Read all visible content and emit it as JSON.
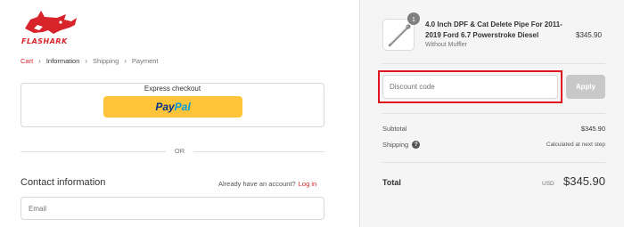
{
  "brand": {
    "logo_text": "FLASHARK",
    "accent_color": "#d8232a"
  },
  "breadcrumb": [
    {
      "label": "Cart",
      "state": "link"
    },
    {
      "label": "Information",
      "state": "current"
    },
    {
      "label": "Shipping",
      "state": "upcoming"
    },
    {
      "label": "Payment",
      "state": "upcoming"
    }
  ],
  "express": {
    "title": "Express checkout",
    "paypal_part1": "Pay",
    "paypal_part2": "Pal"
  },
  "divider_label": "OR",
  "contact": {
    "title": "Contact information",
    "account_prompt": "Already have an account?",
    "login_label": "Log in",
    "email_placeholder": "Email"
  },
  "order": {
    "quantity": "1",
    "product_name": "4.0 Inch DPF & Cat Delete Pipe For 2011-2019 Ford 6.7 Powerstroke Diesel",
    "variant": "Without Muffler",
    "price": "$345.90"
  },
  "discount": {
    "placeholder": "Discount code",
    "apply_label": "Apply"
  },
  "summary": {
    "subtotal_label": "Subtotal",
    "subtotal_value": "$345.90",
    "shipping_label": "Shipping",
    "shipping_value": "Calculated at next step",
    "total_label": "Total",
    "currency": "USD",
    "total_value": "$345.90"
  }
}
